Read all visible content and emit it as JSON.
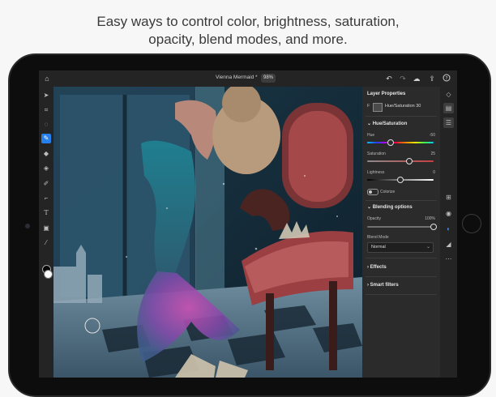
{
  "headline": {
    "line1": "Easy ways to control color, brightness, saturation,",
    "line2": "opacity, blend modes, and more."
  },
  "topbar": {
    "doc_title": "Vienna Mermaid *",
    "zoom": "98%",
    "icons": [
      "home-icon",
      "undo-icon",
      "redo-icon",
      "cloud-icon",
      "share-icon",
      "help-icon"
    ]
  },
  "toolbar": {
    "tools": [
      "move-icon",
      "transform-icon",
      "lasso-icon",
      "brush-icon",
      "eraser-icon",
      "fill-icon",
      "healing-icon",
      "crop-icon",
      "type-icon",
      "image-icon",
      "eyedropper-icon"
    ],
    "active_tool": "brush-icon"
  },
  "panel": {
    "title": "Layer Properties",
    "layer_prefix": "F",
    "layer_name": "Hue/Saturation 30",
    "hue_sat_section": "Hue/Saturation",
    "hue_label": "Hue",
    "hue_value": "-50",
    "hue_fraction": 0.35,
    "saturation_label": "Saturation",
    "saturation_value": "25",
    "saturation_fraction": 0.63,
    "lightness_label": "Lightness",
    "lightness_value": "0",
    "lightness_fraction": 0.5,
    "colorize_label": "Colorize",
    "blending_section": "Blending options",
    "opacity_label": "Opacity",
    "opacity_value": "100%",
    "opacity_fraction": 1.0,
    "blend_mode_label": "Blend Mode",
    "blend_mode_value": "Normal",
    "effects_section": "Effects",
    "smart_filters_section": "Smart filters"
  },
  "rightbar": {
    "icons": [
      "layers-icon",
      "adjustment-layers-icon",
      "properties-icon",
      "add-layer-icon",
      "visibility-icon",
      "mask-icon",
      "fx-icon",
      "more-icon"
    ]
  },
  "colors": {
    "accent": "#2680eb",
    "panel_bg": "#2b2b2b",
    "app_bg": "#1e1e1e"
  }
}
